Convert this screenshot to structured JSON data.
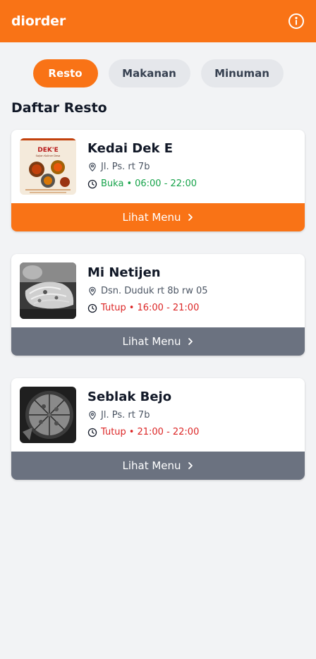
{
  "app": {
    "title": "diorder",
    "info_icon": "info-circle-icon"
  },
  "tabs": [
    {
      "label": "Resto",
      "active": true
    },
    {
      "label": "Makanan",
      "active": false
    },
    {
      "label": "Minuman",
      "active": false
    }
  ],
  "section_title": "Daftar Resto",
  "restaurants": [
    {
      "name": "Kedai Dek E",
      "address": "Jl. Ps. rt 7b",
      "status": "Buka",
      "hours": "06:00 - 22:00",
      "open": true,
      "button_label": "Lihat Menu",
      "thumb_title": "DEK'E",
      "thumb_subtitle": "Sajian Kuliner Desa"
    },
    {
      "name": "Mi Netijen",
      "address": "Dsn. Duduk rt 8b rw 05",
      "status": "Tutup",
      "hours": "16:00 - 21:00",
      "open": false,
      "button_label": "Lihat Menu"
    },
    {
      "name": "Seblak Bejo",
      "address": "Jl. Ps. rt 7b",
      "status": "Tutup",
      "hours": "21:00 - 22:00",
      "open": false,
      "button_label": "Lihat Menu"
    }
  ],
  "status_separator": "•",
  "colors": {
    "primary": "#f97316",
    "open": "#16a34a",
    "closed": "#dc2626",
    "disabled_button": "#6b7280",
    "background": "#f2f3f5"
  }
}
